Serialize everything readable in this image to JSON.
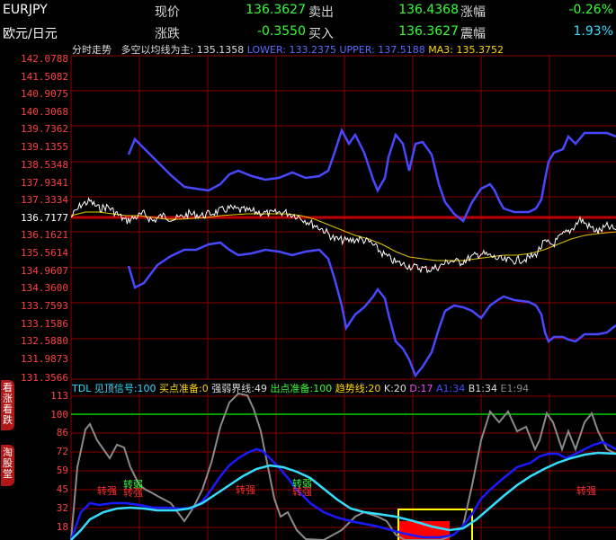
{
  "header": {
    "symbol": "EURJPY",
    "name": "欧元/日元",
    "row1": {
      "now_label": "现价",
      "now_value": "136.3627",
      "sell_label": "卖出",
      "sell_value": "136.4368",
      "change_pct_label": "涨幅",
      "change_pct_value": "-0.26%"
    },
    "row2": {
      "change_label": "涨跌",
      "change_value": "-0.3550",
      "buy_label": "买入",
      "buy_value": "136.3627",
      "amp_label": "震幅",
      "amp_value": "1.93%"
    }
  },
  "main_chart": {
    "title": "分时走势",
    "indicator_label": "多空以均线为主:",
    "indicator_value": "135.1358",
    "lower_label": "LOWER:",
    "lower_value": "133.2375",
    "upper_label": "UPPER:",
    "upper_value": "137.5188",
    "ma_label": "MA3:",
    "ma_value": "135.3752",
    "yticks": [
      "142.0788",
      "141.5082",
      "140.9075",
      "140.3068",
      "139.7362",
      "139.1355",
      "138.5348",
      "137.9341",
      "137.3334",
      "136.7177",
      "136.1621",
      "135.5614",
      "134.9607",
      "134.3600",
      "133.7593",
      "133.1586",
      "132.5880",
      "131.9873",
      "131.3566"
    ],
    "current_tick": "136.7177"
  },
  "sub_chart": {
    "tdl": "TDL",
    "sig1_label": "见顶信号:",
    "sig1_value": "100",
    "sig2_label": "买点准备:",
    "sig2_value": "0",
    "sig3_label": "强弱界线:",
    "sig3_value": "49",
    "sig4_label": "出点准备:",
    "sig4_value": "100",
    "sig5_label": "趋势线:",
    "sig5_value": "20",
    "k_label": "K:",
    "k_value": "20",
    "d_label": "D:",
    "d_value": "17",
    "a1_label": "A1:",
    "a1_value": "34",
    "b1_label": "B1:",
    "b1_value": "34",
    "e1_label": "E1:",
    "e1_value": "94",
    "yticks": [
      "113",
      "100",
      "86",
      "72",
      "59",
      "45",
      "32",
      "18"
    ],
    "annotations": {
      "weak_turn": "转弱",
      "strong_turn": "转强"
    }
  },
  "side_tabs": {
    "tab1": "看涨看跌",
    "tab2": "淘股堂"
  },
  "colors": {
    "grid": "#8b0000",
    "price": "#ffffff",
    "ma": "#ffd700",
    "band": "#4040ff",
    "hline": "#c00000",
    "line100": "#00cc00"
  }
}
